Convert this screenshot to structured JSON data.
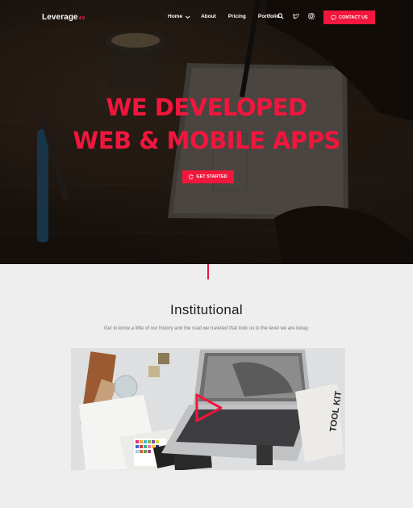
{
  "brand": {
    "name": "Leverage",
    "mark": "4.0"
  },
  "nav": {
    "items": [
      {
        "label": "Home",
        "has_dropdown": true
      },
      {
        "label": "About"
      },
      {
        "label": "Pricing"
      },
      {
        "label": "Portfolio"
      }
    ],
    "contact_label": "CONTACT US"
  },
  "hero": {
    "line1": "WE DEVELOPED",
    "line2": "WEB & MOBILE APPS",
    "cta_label": "GET STARTED"
  },
  "section": {
    "title": "Institutional",
    "subtitle": "Get to know a little of our history and the road we traveled that took us to the level we are today.",
    "kit_text": "TOOL KIT"
  },
  "colors": {
    "accent": "#f1173d",
    "hero_bg": "#241a13",
    "page_bg": "#eeeeee"
  },
  "icons": [
    "search-icon",
    "twitter-icon",
    "instagram-icon",
    "chat-icon",
    "refresh-icon",
    "play-icon"
  ]
}
